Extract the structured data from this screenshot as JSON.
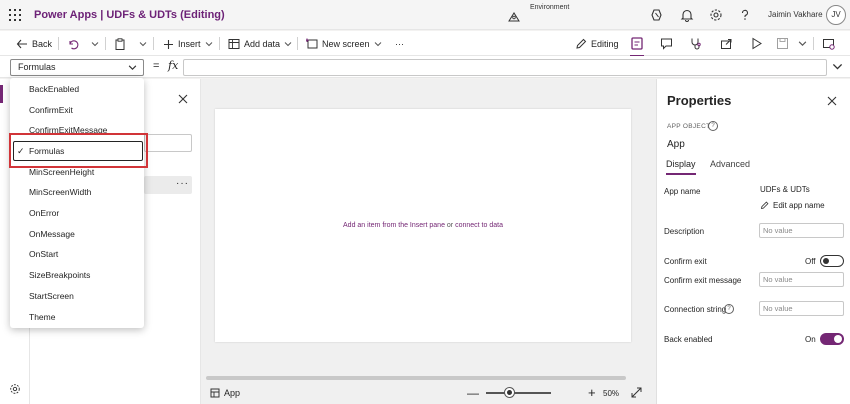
{
  "header": {
    "app_title": "Power Apps  |  UDFs & UDTs (Editing)",
    "environment_label": "Environment",
    "user_name": "Jaimin Vakhare",
    "user_initials": "JV"
  },
  "command_bar": {
    "back_label": "Back",
    "insert_label": "Insert",
    "add_data_label": "Add data",
    "new_screen_label": "New screen",
    "more_label": "···",
    "editing_label": "Editing"
  },
  "formula_bar": {
    "selected_property": "Formulas",
    "equals": "=",
    "fx": "fx",
    "formula_value": ""
  },
  "property_dropdown": {
    "items": [
      {
        "label": "BackEnabled",
        "selected": false
      },
      {
        "label": "ConfirmExit",
        "selected": false
      },
      {
        "label": "ConfirmExitMessage",
        "selected": false
      },
      {
        "label": "Formulas",
        "selected": true
      },
      {
        "label": "MinScreenHeight",
        "selected": false
      },
      {
        "label": "MinScreenWidth",
        "selected": false
      },
      {
        "label": "OnError",
        "selected": false
      },
      {
        "label": "OnMessage",
        "selected": false
      },
      {
        "label": "OnStart",
        "selected": false
      },
      {
        "label": "SizeBreakpoints",
        "selected": false
      },
      {
        "label": "StartScreen",
        "selected": false
      },
      {
        "label": "Theme",
        "selected": false
      }
    ],
    "check_glyph": "✓"
  },
  "tree": {
    "more_label": "···"
  },
  "canvas": {
    "hint_link1": "Add an item from the Insert pane",
    "hint_or": " or ",
    "hint_link2": "connect to data",
    "screen_crumb": "App",
    "zoom_minus": "—",
    "zoom_plus": "+",
    "zoom_level": "50%",
    "zoom_fraction": 0.5
  },
  "properties": {
    "title": "Properties",
    "object_type_label": "APP OBJECT",
    "object_name": "App",
    "tabs": [
      {
        "label": "Display",
        "active": true
      },
      {
        "label": "Advanced",
        "active": false
      }
    ],
    "app_name_label": "App name",
    "app_name_value": "UDFs & UDTs",
    "edit_app_name_label": "Edit app name",
    "description_label": "Description",
    "description_placeholder": "No value",
    "confirm_exit_label": "Confirm exit",
    "confirm_exit_state": "Off",
    "confirm_exit_message_label": "Confirm exit message",
    "confirm_exit_message_placeholder": "No value",
    "connection_string_label": "Connection string",
    "connection_string_placeholder": "No value",
    "back_enabled_label": "Back enabled",
    "back_enabled_state": "On"
  },
  "colors": {
    "brand_purple": "#742774",
    "title_purple": "#6d2277",
    "highlight_red": "#d13438"
  },
  "icons": [
    "waffle-icon",
    "environment-icon",
    "copilot-icon",
    "bell-icon",
    "gear-icon",
    "help-icon",
    "back-arrow-icon",
    "undo-icon",
    "paste-icon",
    "plus-icon",
    "table-icon",
    "new-screen-icon",
    "pencil-icon",
    "app-checker-icon",
    "comment-icon",
    "stethoscope-icon",
    "share-icon",
    "play-icon",
    "save-icon",
    "publish-icon",
    "chevron-down-icon",
    "close-icon",
    "settings-icon",
    "screen-icon",
    "fit-icon",
    "check-icon"
  ]
}
